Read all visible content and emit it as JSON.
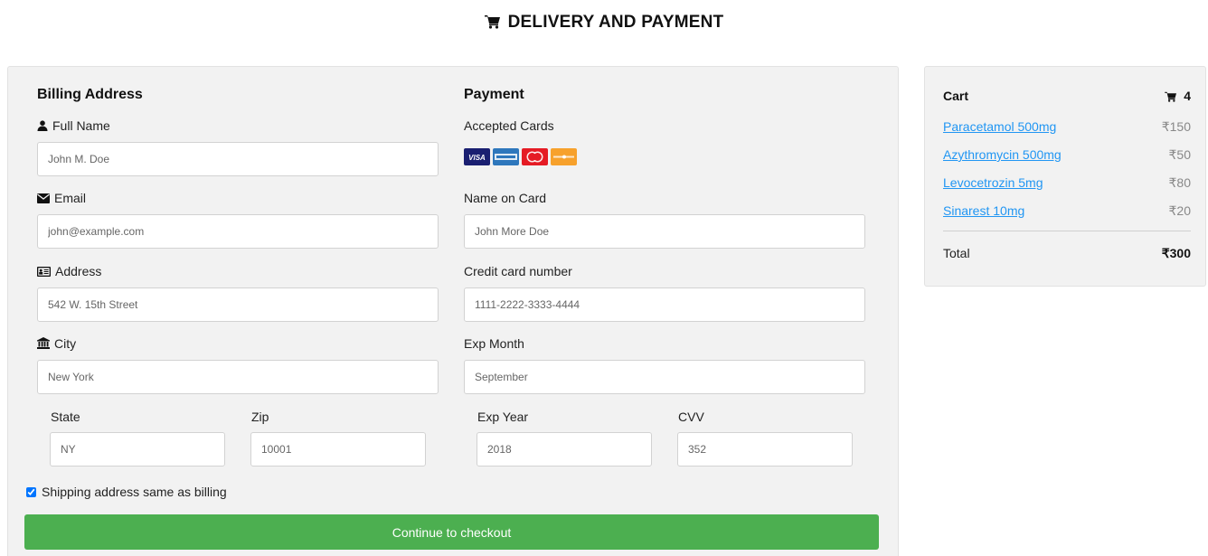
{
  "page": {
    "title": "DELIVERY AND PAYMENT"
  },
  "billing": {
    "heading": "Billing Address",
    "full_name": {
      "label": "Full Name",
      "placeholder": "John M. Doe",
      "icon": "user-icon"
    },
    "email": {
      "label": "Email",
      "placeholder": "john@example.com",
      "icon": "envelope-icon"
    },
    "address": {
      "label": "Address",
      "placeholder": "542 W. 15th Street",
      "icon": "address-card-icon"
    },
    "city": {
      "label": "City",
      "placeholder": "New York",
      "icon": "institution-icon"
    },
    "state": {
      "label": "State",
      "placeholder": "NY"
    },
    "zip": {
      "label": "Zip",
      "placeholder": "10001"
    }
  },
  "payment": {
    "heading": "Payment",
    "accepted_cards_label": "Accepted Cards",
    "cards": [
      "visa-icon",
      "amex-icon",
      "mastercard-icon",
      "discover-icon"
    ],
    "name_on_card": {
      "label": "Name on Card",
      "placeholder": "John More Doe"
    },
    "card_number": {
      "label": "Credit card number",
      "placeholder": "1111-2222-3333-4444"
    },
    "exp_month": {
      "label": "Exp Month",
      "placeholder": "September"
    },
    "exp_year": {
      "label": "Exp Year",
      "placeholder": "2018"
    },
    "cvv": {
      "label": "CVV",
      "placeholder": "352"
    }
  },
  "shipping_same": {
    "label": "Shipping address same as billing",
    "checked": true
  },
  "checkout_button": {
    "label": "Continue to checkout",
    "color": "#4caf50"
  },
  "cart": {
    "title": "Cart",
    "count": "4",
    "items": [
      {
        "name": "Paracetamol 500mg",
        "price": "₹150"
      },
      {
        "name": "Azythromycin 500mg",
        "price": "₹50"
      },
      {
        "name": "Levocetrozin 5mg",
        "price": "₹80"
      },
      {
        "name": "Sinarest 10mg",
        "price": "₹20"
      }
    ],
    "total_label": "Total",
    "total_value": "₹300",
    "link_color": "#2196f3"
  }
}
